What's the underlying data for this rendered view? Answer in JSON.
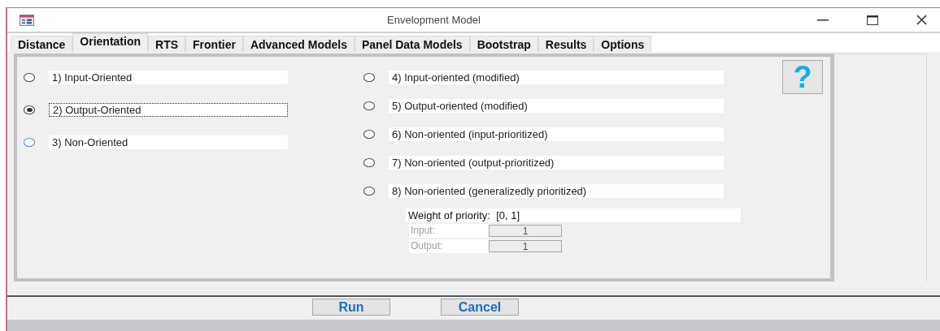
{
  "window": {
    "title": "Envelopment Model"
  },
  "tabs": [
    {
      "label": "Distance",
      "selected": false
    },
    {
      "label": "Orientation",
      "selected": true
    },
    {
      "label": "RTS",
      "selected": false
    },
    {
      "label": "Frontier",
      "selected": false
    },
    {
      "label": "Advanced Models",
      "selected": false
    },
    {
      "label": "Panel Data Models",
      "selected": false
    },
    {
      "label": "Bootstrap",
      "selected": false
    },
    {
      "label": "Results",
      "selected": false
    },
    {
      "label": "Options",
      "selected": false
    }
  ],
  "left_options": [
    {
      "label": "1) Input-Oriented",
      "selected": false,
      "focused": false,
      "hovered": false
    },
    {
      "label": "2) Output-Oriented",
      "selected": true,
      "focused": true,
      "hovered": false
    },
    {
      "label": "3) Non-Oriented",
      "selected": false,
      "focused": false,
      "hovered": true
    }
  ],
  "right_options": [
    {
      "label": "4) Input-oriented (modified)",
      "selected": false
    },
    {
      "label": "5) Output-oriented (modified)",
      "selected": false
    },
    {
      "label": "6) Non-oriented (input-prioritized)",
      "selected": false
    },
    {
      "label": "7) Non-oriented (output-prioritized)",
      "selected": false
    },
    {
      "label": "8) Non-oriented (generalizedly prioritized)",
      "selected": false
    }
  ],
  "help_button": {
    "label": "?"
  },
  "weight": {
    "title": "Weight of priority:  [0, 1]",
    "fields": [
      {
        "label": "Input:",
        "value": "1",
        "disabled": true
      },
      {
        "label": "Output:",
        "value": "1",
        "disabled": true
      }
    ]
  },
  "buttons": [
    {
      "label": "Run"
    },
    {
      "label": "Cancel"
    }
  ]
}
